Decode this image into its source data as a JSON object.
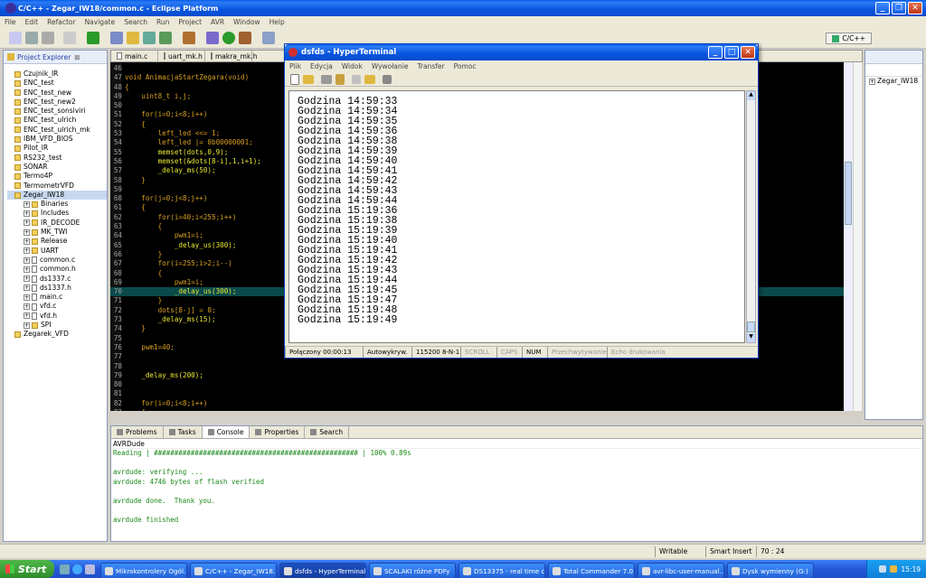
{
  "eclipse": {
    "title": "C/C++ - Zegar_IW18/common.c - Eclipse Platform",
    "menu": [
      "File",
      "Edit",
      "Refactor",
      "Navigate",
      "Search",
      "Run",
      "Project",
      "AVR",
      "Window",
      "Help"
    ],
    "perspective": "C/C++",
    "editor_tabs": [
      "main.c",
      "uart_mk.h",
      "makra_mk.h"
    ],
    "project_explorer": {
      "title": "Project Explorer",
      "items": [
        {
          "label": "Czujnik_IR",
          "level": 0,
          "type": "folder"
        },
        {
          "label": "ENC_test",
          "level": 0,
          "type": "folder"
        },
        {
          "label": "ENC_test_new",
          "level": 0,
          "type": "folder"
        },
        {
          "label": "ENC_test_new2",
          "level": 0,
          "type": "folder"
        },
        {
          "label": "ENC_test_sonsiviri",
          "level": 0,
          "type": "folder"
        },
        {
          "label": "ENC_test_ulrich",
          "level": 0,
          "type": "folder"
        },
        {
          "label": "ENC_test_ulrich_mk",
          "level": 0,
          "type": "folder"
        },
        {
          "label": "IBM_VFD_BIOS",
          "level": 0,
          "type": "folder"
        },
        {
          "label": "Pilot_IR",
          "level": 0,
          "type": "folder"
        },
        {
          "label": "RS232_test",
          "level": 0,
          "type": "folder"
        },
        {
          "label": "SONAR",
          "level": 0,
          "type": "folder"
        },
        {
          "label": "Termo4P",
          "level": 0,
          "type": "folder"
        },
        {
          "label": "TermometrVFD",
          "level": 0,
          "type": "folder"
        },
        {
          "label": "Zegar_IW18",
          "level": 0,
          "type": "folder",
          "selected": true
        },
        {
          "label": "Binaries",
          "level": 1,
          "type": "folder"
        },
        {
          "label": "Includes",
          "level": 1,
          "type": "folder"
        },
        {
          "label": "IR_DECODE",
          "level": 1,
          "type": "folder"
        },
        {
          "label": "MK_TWI",
          "level": 1,
          "type": "folder"
        },
        {
          "label": "Release",
          "level": 1,
          "type": "folder"
        },
        {
          "label": "UART",
          "level": 1,
          "type": "folder"
        },
        {
          "label": "common.c",
          "level": 1,
          "type": "file"
        },
        {
          "label": "common.h",
          "level": 1,
          "type": "file"
        },
        {
          "label": "ds1337.c",
          "level": 1,
          "type": "file"
        },
        {
          "label": "ds1337.h",
          "level": 1,
          "type": "file"
        },
        {
          "label": "main.c",
          "level": 1,
          "type": "file"
        },
        {
          "label": "vfd.c",
          "level": 1,
          "type": "file"
        },
        {
          "label": "vfd.h",
          "level": 1,
          "type": "file"
        },
        {
          "label": "SPI",
          "level": 1,
          "type": "folder"
        },
        {
          "label": "Zegarek_VFD",
          "level": 0,
          "type": "folder"
        }
      ]
    },
    "code_lines": [
      {
        "n": "46",
        "t": ""
      },
      {
        "n": "47",
        "t": "void AnimacjaStartZegara(void)"
      },
      {
        "n": "48",
        "t": "{"
      },
      {
        "n": "49",
        "t": "    uint8_t i,j;"
      },
      {
        "n": "50",
        "t": ""
      },
      {
        "n": "51",
        "t": "    for(i=0;i<8;i++)"
      },
      {
        "n": "52",
        "t": "    {"
      },
      {
        "n": "53",
        "t": "        left_led <<= 1;"
      },
      {
        "n": "54",
        "t": "        left_led |= 0b00000001;"
      },
      {
        "n": "55",
        "t": "        memset(dots,0,9);"
      },
      {
        "n": "56",
        "t": "        memset(&dots[8-i],1,i+1);"
      },
      {
        "n": "57",
        "t": "        _delay_ms(50);"
      },
      {
        "n": "58",
        "t": "    }"
      },
      {
        "n": "59",
        "t": ""
      },
      {
        "n": "60",
        "t": "    for(j=0;j<8;j++)"
      },
      {
        "n": "61",
        "t": "    {"
      },
      {
        "n": "62",
        "t": "        for(i=40;i<255;i++)"
      },
      {
        "n": "63",
        "t": "        {"
      },
      {
        "n": "64",
        "t": "            pwm1=i;"
      },
      {
        "n": "65",
        "t": "            _delay_us(300);"
      },
      {
        "n": "66",
        "t": "        }"
      },
      {
        "n": "67",
        "t": "        for(i=255;i>2;i--)"
      },
      {
        "n": "68",
        "t": "        {"
      },
      {
        "n": "69",
        "t": "            pwm1=i;"
      },
      {
        "n": "70",
        "t": "            _delay_us(300);"
      },
      {
        "n": "71",
        "t": "        }"
      },
      {
        "n": "72",
        "t": "        dots[8-j] = 0;"
      },
      {
        "n": "73",
        "t": "        _delay_ms(15);"
      },
      {
        "n": "74",
        "t": "    }"
      },
      {
        "n": "75",
        "t": ""
      },
      {
        "n": "76",
        "t": "    pwm1=40;"
      },
      {
        "n": "77",
        "t": ""
      },
      {
        "n": "78",
        "t": ""
      },
      {
        "n": "79",
        "t": "    _delay_ms(200);"
      },
      {
        "n": "80",
        "t": ""
      },
      {
        "n": "81",
        "t": ""
      },
      {
        "n": "82",
        "t": "    for(i=0;i<8;i++)"
      },
      {
        "n": "83",
        "t": "    {"
      }
    ],
    "highlighted_line": "70",
    "outline_item": "Zegar_IW18",
    "bottom_tabs": [
      "Problems",
      "Tasks",
      "Console",
      "Properties",
      "Search"
    ],
    "console_title": "AVRDude",
    "console_lines": [
      "Reading | ################################################## | 100% 0.89s",
      "",
      "avrdude: verifying ...",
      "avrdude: 4746 bytes of flash verified",
      "",
      "avrdude done.  Thank you.",
      "",
      "avrdude finished"
    ],
    "status": {
      "writable": "Writable",
      "insert": "Smart Insert",
      "position": "70 : 24"
    }
  },
  "hyperterminal": {
    "title": "dsfds - HyperTerminal",
    "menu": [
      "Plik",
      "Edycja",
      "Widok",
      "Wywołanie",
      "Transfer",
      "Pomoc"
    ],
    "lines": [
      "Godzina 14:59:33",
      "Godzina 14:59:34",
      "Godzina 14:59:35",
      "Godzina 14:59:36",
      "Godzina 14:59:38",
      "Godzina 14:59:39",
      "Godzina 14:59:40",
      "Godzina 14:59:41",
      "Godzina 14:59:42",
      "Godzina 14:59:43",
      "Godzina 14:59:44",
      "Godzina 15:19:36",
      "Godzina 15:19:38",
      "Godzina 15:19:39",
      "Godzina 15:19:40",
      "Godzina 15:19:41",
      "Godzina 15:19:42",
      "Godzina 15:19:43",
      "Godzina 15:19:44",
      "Godzina 15:19:45",
      "Godzina 15:19:47",
      "Godzina 15:19:48",
      "Godzina 15:19:49"
    ],
    "status": [
      "Połączony 00:00:13",
      "Autowykryw.",
      "115200 8-N-1",
      "SCROLL",
      "CAPS",
      "NUM",
      "Przechwytywanie",
      "Echo drukowania"
    ]
  },
  "taskbar": {
    "start": "Start",
    "buttons": [
      "Mikrokontrolery Ogól...",
      "C/C++ - Zegar_IW18...",
      "dsfds - HyperTerminal",
      "SCALAKI różne PDFy",
      "DS13375 - real time cl...",
      "Total Commander 7.0...",
      "avr-libc-user-manual....",
      "Dysk wymienny (G:)"
    ],
    "active_index": 2,
    "clock": "15:19"
  }
}
